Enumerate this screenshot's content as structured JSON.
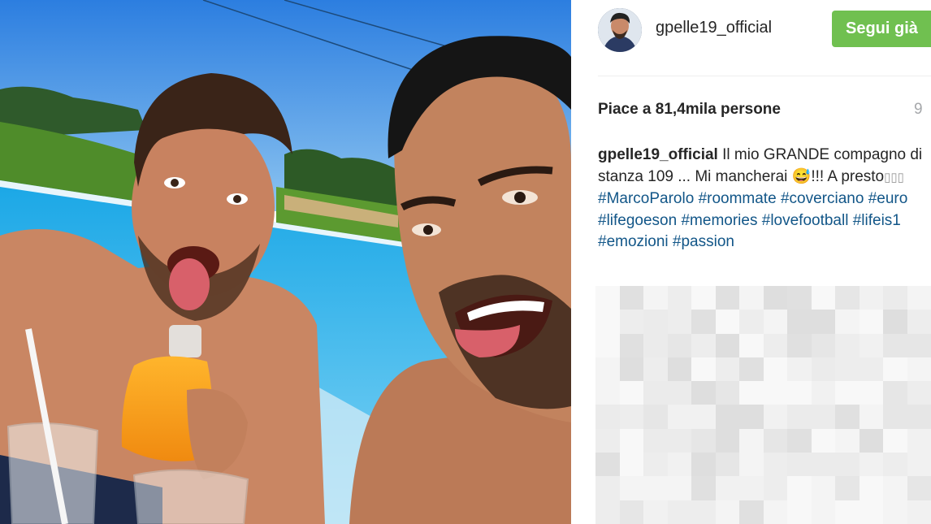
{
  "photo": {
    "description_icon": "selfie-photo"
  },
  "header": {
    "username": "gpelle19_official",
    "follow_label": "Segui già"
  },
  "likes": "Piace a 81,4mila persone",
  "time_ago": "9",
  "caption": {
    "username": "gpelle19_official",
    "text_1": " Il mio GRANDE compagno di stanza 109 ... Mi mancherai ",
    "emoji": "😅",
    "text_2": "!!! A presto",
    "boxes": "▯▯▯",
    "hashtags": [
      "#MarcoParolo",
      "#roommate",
      "#coverciano",
      "#euro",
      "#lifegoeson",
      "#memories",
      "#lovefootball",
      "#lifeis1",
      "#emozioni",
      "#passion"
    ]
  },
  "comments_obscured": true,
  "colors": {
    "follow_bg": "#70c050",
    "hashtag": "#125688",
    "time": "#a5a7aa"
  }
}
